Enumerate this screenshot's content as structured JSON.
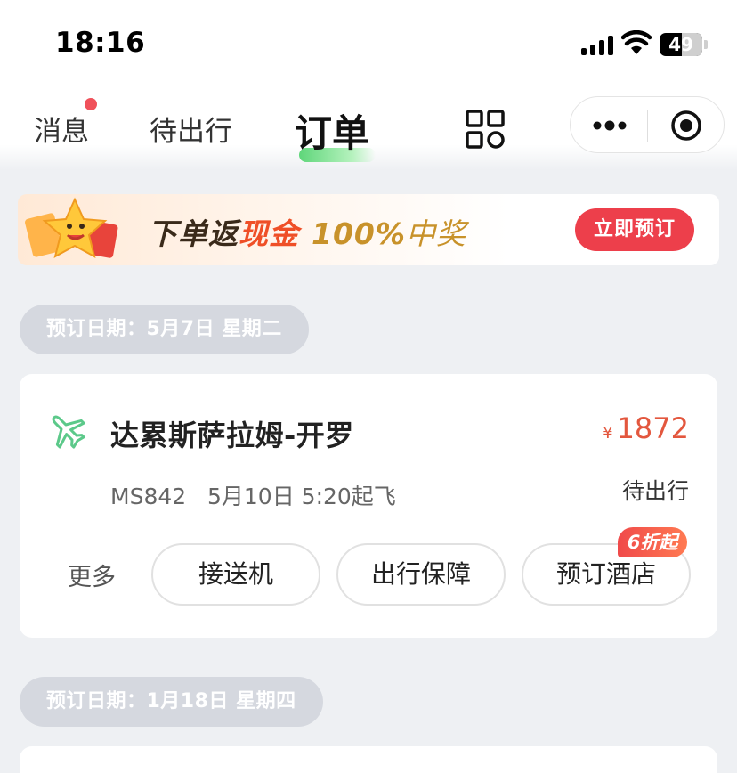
{
  "status_bar": {
    "time": "18:16",
    "battery": "49"
  },
  "tabs": [
    {
      "label": "消息",
      "has_badge": true
    },
    {
      "label": "待出行"
    },
    {
      "label": "订单",
      "active": true
    }
  ],
  "banner": {
    "text_part1": "下单返",
    "text_part2": "现金",
    "text_part3": "100%",
    "text_part4": "中奖",
    "button": "立即预订"
  },
  "orders": [
    {
      "date_label": "预订日期：5月7日 星期二",
      "route": "达累斯萨拉姆-开罗",
      "currency": "¥",
      "price": "1872",
      "flight_info": "MS842   5月10日 5:20起飞",
      "status": "待出行",
      "more_label": "更多",
      "actions": [
        "接送机",
        "出行保障",
        "预订酒店"
      ],
      "hotel_badge": "6折起"
    },
    {
      "date_label": "预订日期：1月18日 星期四"
    }
  ],
  "colors": {
    "accent_red": "#ed3f4b",
    "price": "#e3573e",
    "plane_icon": "#5cc98a",
    "tab_underline": "#5fd67a"
  }
}
